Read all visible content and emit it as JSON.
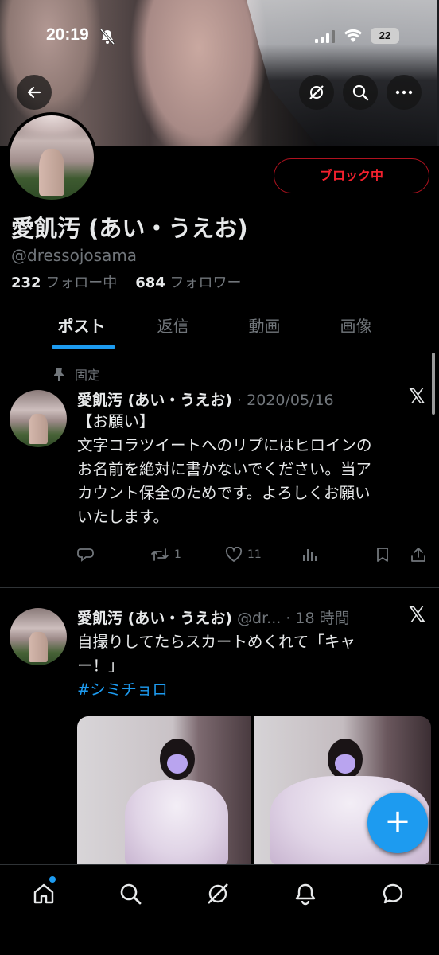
{
  "status_bar": {
    "time": "20:19",
    "battery": "22"
  },
  "profile": {
    "block_label": "ブロック中",
    "display_name": "愛飢汚 (あい・うえお)",
    "handle": "@dressojosama",
    "following_count": "232",
    "following_label": "フォロー中",
    "followers_count": "684",
    "followers_label": "フォロワー"
  },
  "tabs": [
    {
      "label": "ポスト",
      "active": true
    },
    {
      "label": "返信",
      "active": false
    },
    {
      "label": "動画",
      "active": false
    },
    {
      "label": "画像",
      "active": false
    }
  ],
  "posts": [
    {
      "pinned_label": "固定",
      "author": "愛飢汚 (あい・うえお)",
      "meta": "· 2020/05/16",
      "lines": [
        "【お願い】",
        "文字コラツイートへのリプにはヒロインの",
        "お名前を絶対に書かないでください。当ア",
        "カウント保全のためです。よろしくお願い",
        "いたします。"
      ],
      "retweets": "1",
      "likes": "11"
    },
    {
      "author": "愛飢汚 (あい・うえお)",
      "meta": "@dr... · 18 時間",
      "lines": [
        "自撮りしてたらスカートめくれて「キャ",
        "ー！」"
      ],
      "hashtag": "#シミチョロ"
    }
  ],
  "fab_label": "+",
  "colors": {
    "accent": "#1d9bf0",
    "block_red": "#f4212e",
    "muted": "#71767b"
  }
}
